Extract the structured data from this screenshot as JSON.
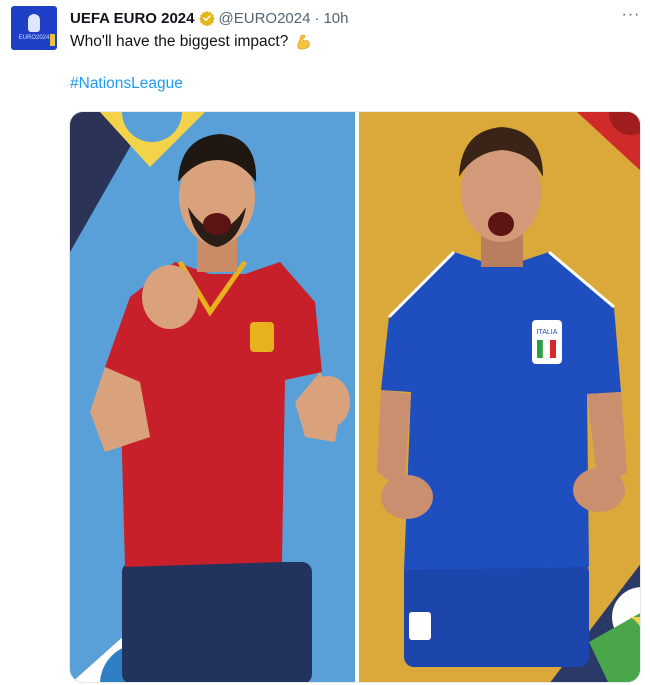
{
  "tweet": {
    "display_name": "UEFA EURO 2024",
    "handle": "@EURO2024",
    "separator": "·",
    "time": "10h",
    "text": "Who'll have the biggest impact?",
    "hashtag": "#NationsLeague",
    "more_label": "···"
  },
  "avatar": {
    "caption": "EURO2024"
  },
  "media": {
    "left_kit": {
      "badge_text": ""
    },
    "right_kit": {
      "badge_text": "ITALIA"
    }
  },
  "colors": {
    "link": "#1d9bf0",
    "verified": "#e2b719",
    "spain_red": "#c8202a",
    "italy_blue": "#1f4fbf"
  },
  "icons": [
    "verified-badge-icon",
    "flexed-biceps-emoji",
    "more-options-icon"
  ]
}
